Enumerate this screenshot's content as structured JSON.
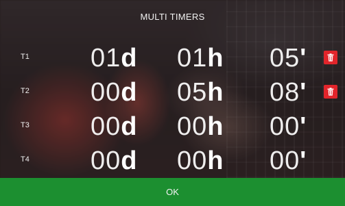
{
  "header": {
    "title": "MULTI TIMERS"
  },
  "timers": [
    {
      "label": "T1",
      "days": "01",
      "days_unit": "d",
      "hours": "01",
      "hours_unit": "h",
      "minutes": "05",
      "minutes_unit": "'",
      "delete_visible": true
    },
    {
      "label": "T2",
      "days": "00",
      "days_unit": "d",
      "hours": "05",
      "hours_unit": "h",
      "minutes": "08",
      "minutes_unit": "'",
      "delete_visible": true
    },
    {
      "label": "T3",
      "days": "00",
      "days_unit": "d",
      "hours": "00",
      "hours_unit": "h",
      "minutes": "00",
      "minutes_unit": "'",
      "delete_visible": false
    },
    {
      "label": "T4",
      "days": "00",
      "days_unit": "d",
      "hours": "00",
      "hours_unit": "h",
      "minutes": "00",
      "minutes_unit": "'",
      "delete_visible": false
    }
  ],
  "footer": {
    "ok_label": "OK"
  },
  "colors": {
    "delete": "#e2252b",
    "ok_bar": "#1c8f30",
    "text": "#ffffff"
  },
  "icons": {
    "delete": "trash-icon"
  }
}
